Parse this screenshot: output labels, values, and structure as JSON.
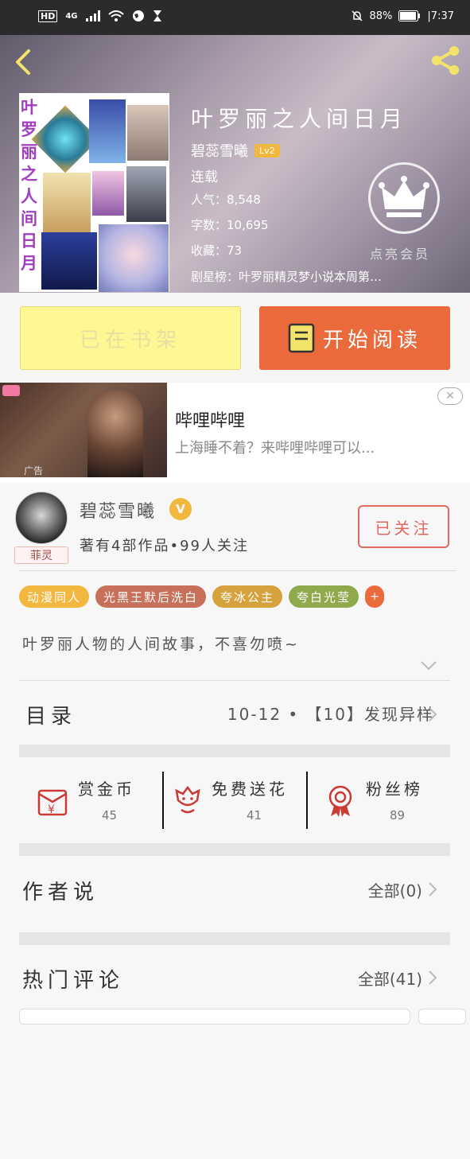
{
  "status_bar": {
    "left_icons": [
      "HD",
      "4G"
    ],
    "battery": "88%",
    "time": "7:37"
  },
  "book": {
    "title": "叶罗丽之人间日月",
    "author": "碧蕊雪曦",
    "author_level": "Lv2",
    "status": "连载",
    "popularity_label": "人气：",
    "popularity": "8,548",
    "words_label": "字数：",
    "words": "10,695",
    "favorites_label": "收藏：",
    "favorites": "73",
    "rank_text": "剧星榜：叶罗丽精灵梦小说本周第…",
    "vip_label": "点亮会员"
  },
  "cover_text": "叶罗丽之人间日月",
  "buttons": {
    "shelf": "已在书架",
    "read": "开始阅读"
  },
  "ad": {
    "title": "哔哩哔哩",
    "subtitle": "上海睡不着？来哔哩哔哩可以...",
    "label": "广告",
    "close": "✕"
  },
  "author_section": {
    "name": "碧蕊雪曦",
    "badge": "菲灵",
    "info": "著有4部作品•99人关注",
    "follow": "已关注",
    "tags": [
      {
        "label": "动漫同人",
        "color": "#f2b73f"
      },
      {
        "label": "光黑王默后洗白",
        "color": "#c7705a"
      },
      {
        "label": "夸冰公主",
        "color": "#d6a23e"
      },
      {
        "label": "夸白光莹",
        "color": "#8faa4d"
      }
    ],
    "tag_more": "+",
    "description": "叶罗丽人物的人间故事，不喜勿喷~"
  },
  "toc": {
    "label": "目录",
    "latest": "10-12 • 【10】发现异样"
  },
  "gifts": [
    {
      "label": "赏金币",
      "count": "45",
      "icon": "gold-coin-envelope-icon"
    },
    {
      "label": "免费送花",
      "count": "41",
      "icon": "flower-icon"
    },
    {
      "label": "粉丝榜",
      "count": "89",
      "icon": "medal-icon"
    }
  ],
  "author_say": {
    "label": "作者说",
    "all": "全部(0)"
  },
  "hot_comments": {
    "label": "热门评论",
    "all": "全部(41)"
  },
  "colors": {
    "accent": "#ea6a3b",
    "shelf_button": "#fff694",
    "status_bar": "#2b2b2b"
  }
}
